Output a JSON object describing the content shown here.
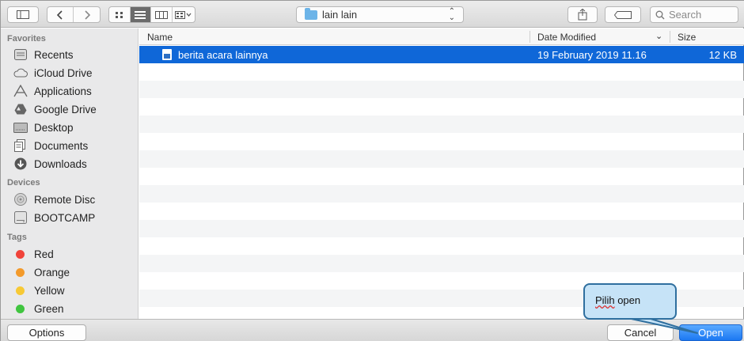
{
  "toolbar": {
    "path_label": "lain lain",
    "search_placeholder": "Search",
    "icons": [
      "sidebar-toggle-icon",
      "back-icon",
      "forward-icon",
      "icon-view-icon",
      "list-view-icon",
      "column-view-icon",
      "gallery-view-icon",
      "share-icon",
      "tag-icon",
      "search-icon"
    ]
  },
  "sidebar": {
    "favorites_heading": "Favorites",
    "favorites": [
      {
        "label": "Recents",
        "icon": "recents-icon"
      },
      {
        "label": "iCloud Drive",
        "icon": "cloud-icon"
      },
      {
        "label": "Applications",
        "icon": "applications-icon"
      },
      {
        "label": "Google Drive",
        "icon": "google-drive-icon"
      },
      {
        "label": "Desktop",
        "icon": "desktop-icon"
      },
      {
        "label": "Documents",
        "icon": "documents-icon"
      },
      {
        "label": "Downloads",
        "icon": "downloads-icon"
      }
    ],
    "devices_heading": "Devices",
    "devices": [
      {
        "label": "Remote Disc",
        "icon": "disc-icon"
      },
      {
        "label": "BOOTCAMP",
        "icon": "drive-icon"
      }
    ],
    "tags_heading": "Tags",
    "tags": [
      {
        "label": "Red",
        "color": "#f0433a"
      },
      {
        "label": "Orange",
        "color": "#f39a2b"
      },
      {
        "label": "Yellow",
        "color": "#f7c935"
      },
      {
        "label": "Green",
        "color": "#40c540"
      }
    ]
  },
  "columns": {
    "name": "Name",
    "date_modified": "Date Modified",
    "size": "Size"
  },
  "files": [
    {
      "name": "berita acara lainnya",
      "date": "19 February 2019 11.16",
      "size": "12 KB",
      "selected": true
    }
  ],
  "bottom": {
    "options_label": "Options",
    "cancel_label": "Cancel",
    "open_label": "Open"
  },
  "callout": {
    "word1": "Pilih",
    "word2": " open"
  },
  "colors": {
    "selection": "#0f67d8",
    "callout_fill": "#c6e3f7",
    "callout_border": "#2f6f9f"
  }
}
